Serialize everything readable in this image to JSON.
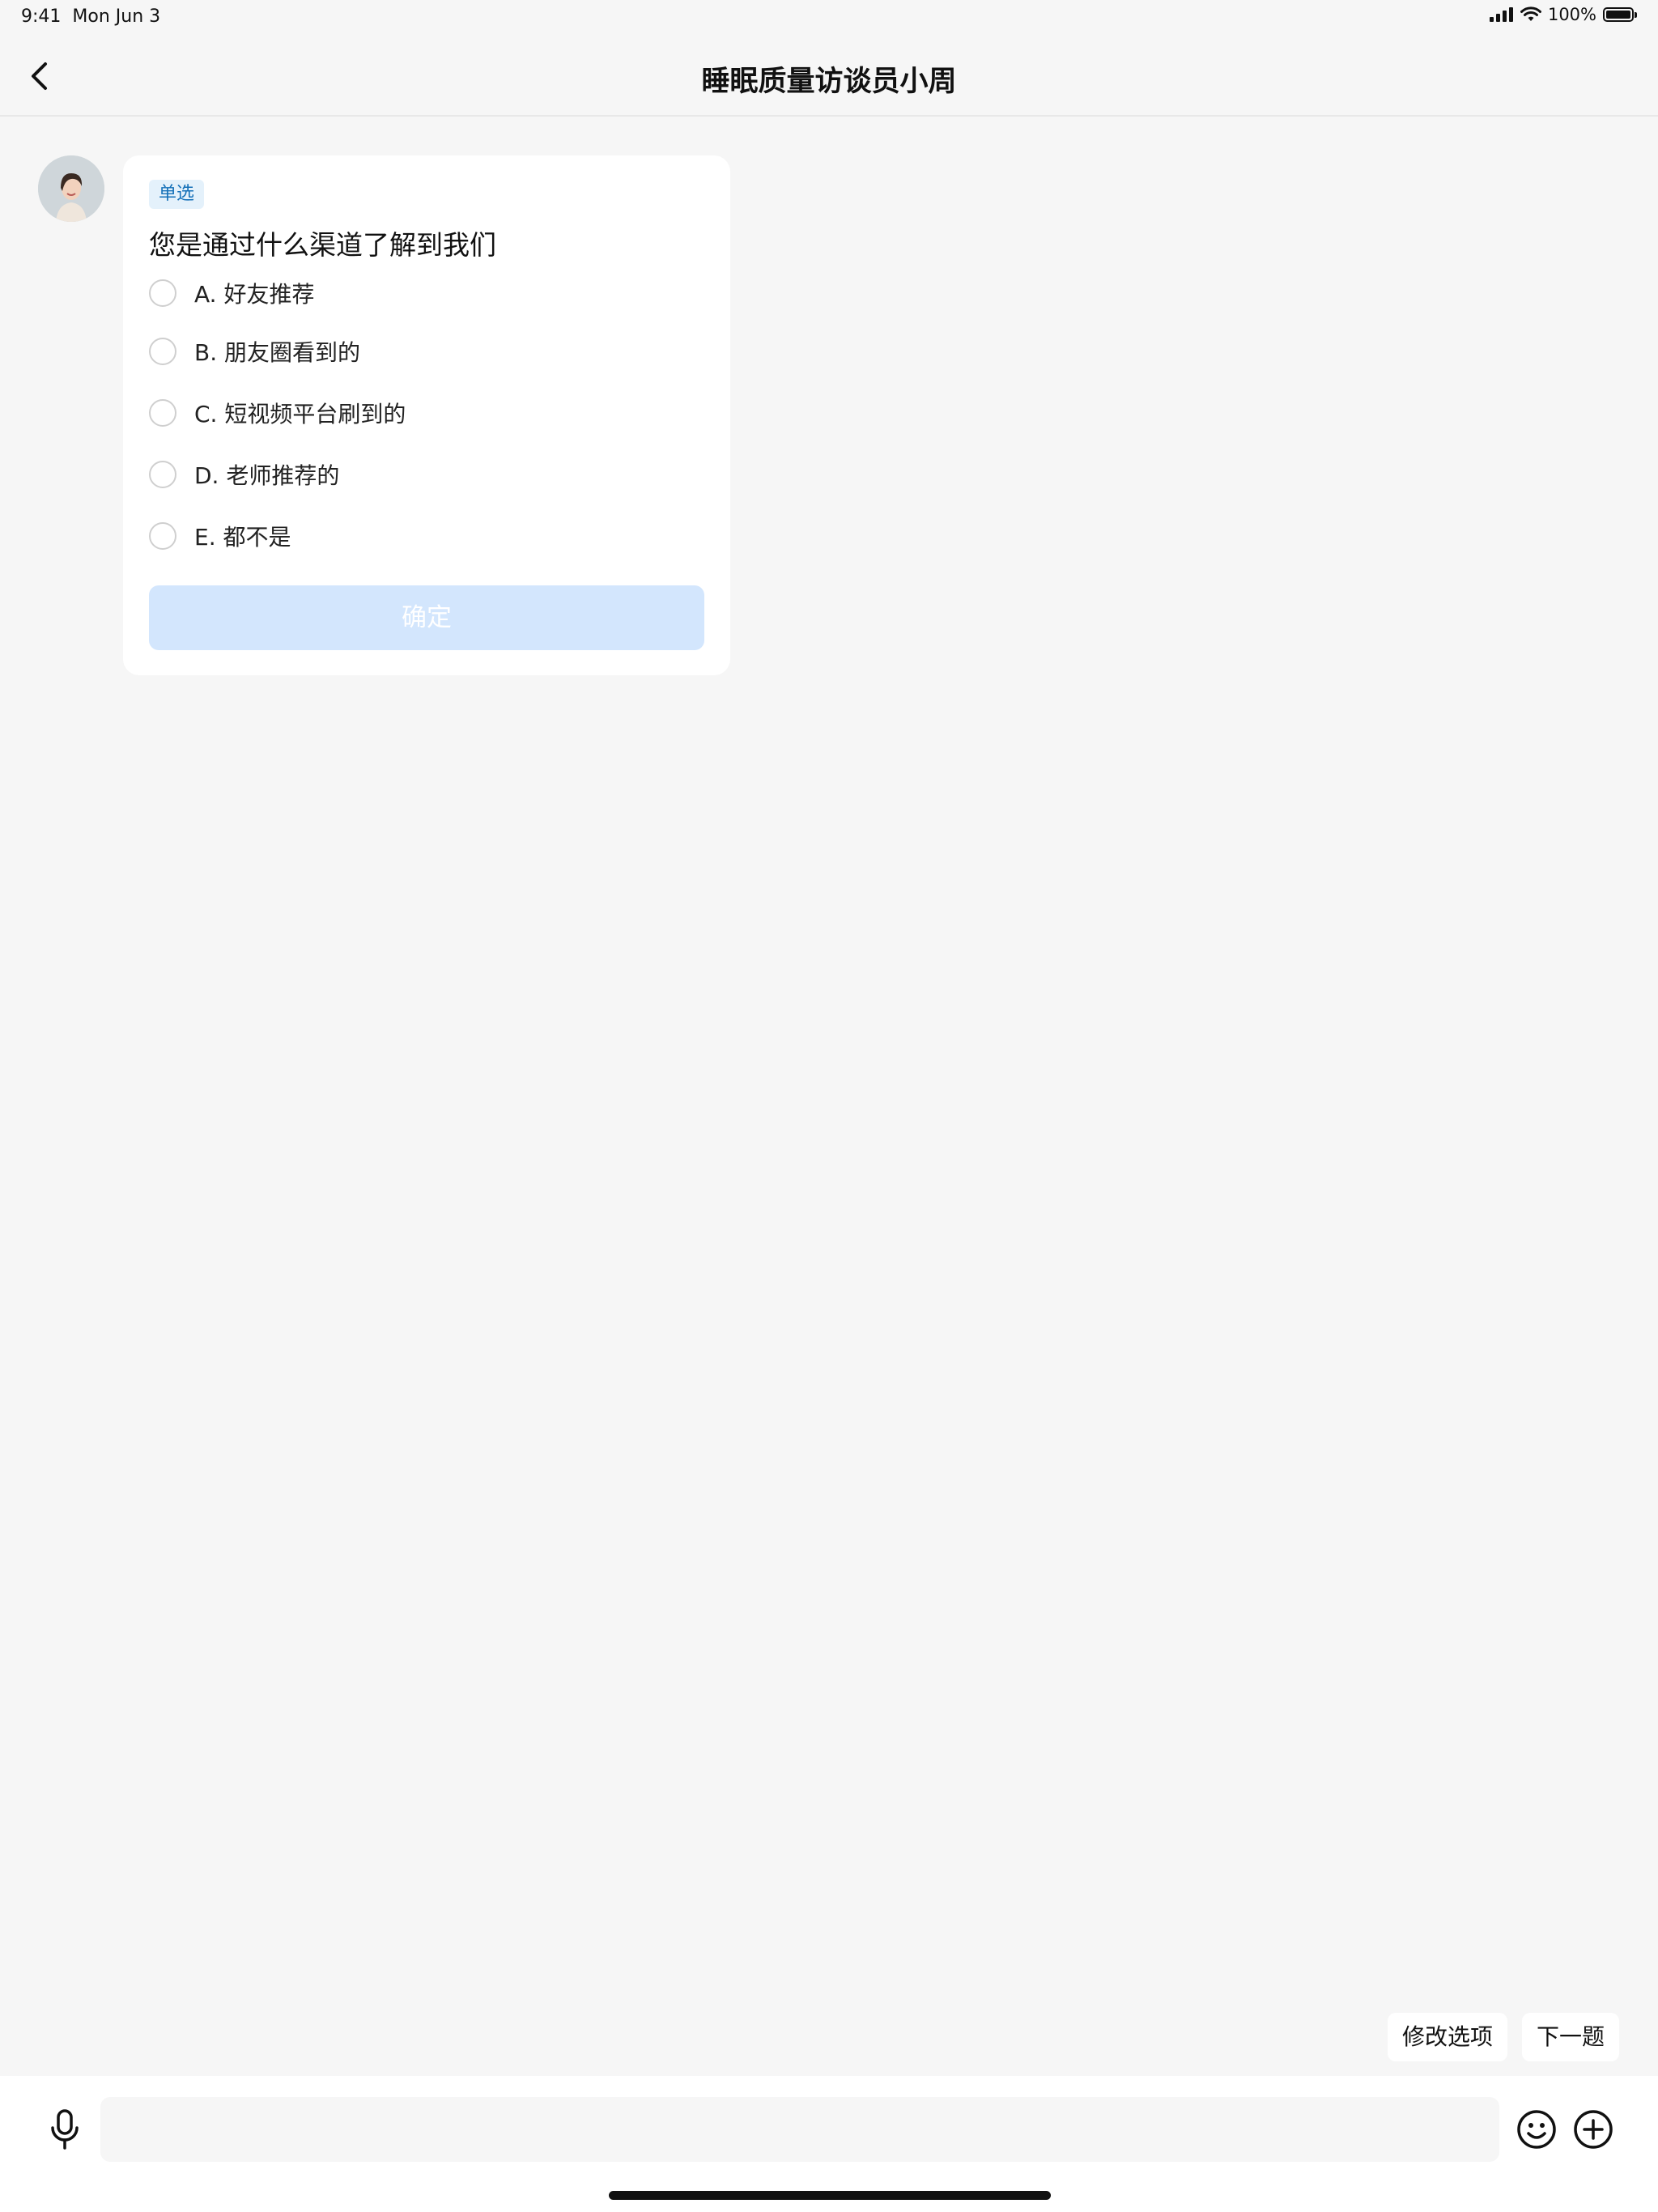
{
  "status_bar": {
    "time": "9:41",
    "date": "Mon Jun 3",
    "battery": "100%"
  },
  "nav": {
    "title": "睡眠质量访谈员小周",
    "back_icon": "chevron-left-icon"
  },
  "message": {
    "tag": "单选",
    "question": "您是通过什么渠道了解到我们",
    "options": [
      {
        "label": "A. 好友推荐"
      },
      {
        "label": "B. 朋友圈看到的"
      },
      {
        "label": "C. 短视频平台刷到的"
      },
      {
        "label": "D. 老师推荐的"
      },
      {
        "label": "E. 都不是"
      }
    ],
    "confirm_label": "确定"
  },
  "quick_actions": {
    "modify": "修改选项",
    "next": "下一题"
  },
  "input_bar": {
    "placeholder": "",
    "mic_icon": "microphone-icon",
    "emoji_icon": "emoji-icon",
    "plus_icon": "plus-circle-icon"
  },
  "colors": {
    "accent": "#1470b8",
    "confirm_disabled": "#d3e6fd",
    "background": "#f6f6f6"
  }
}
